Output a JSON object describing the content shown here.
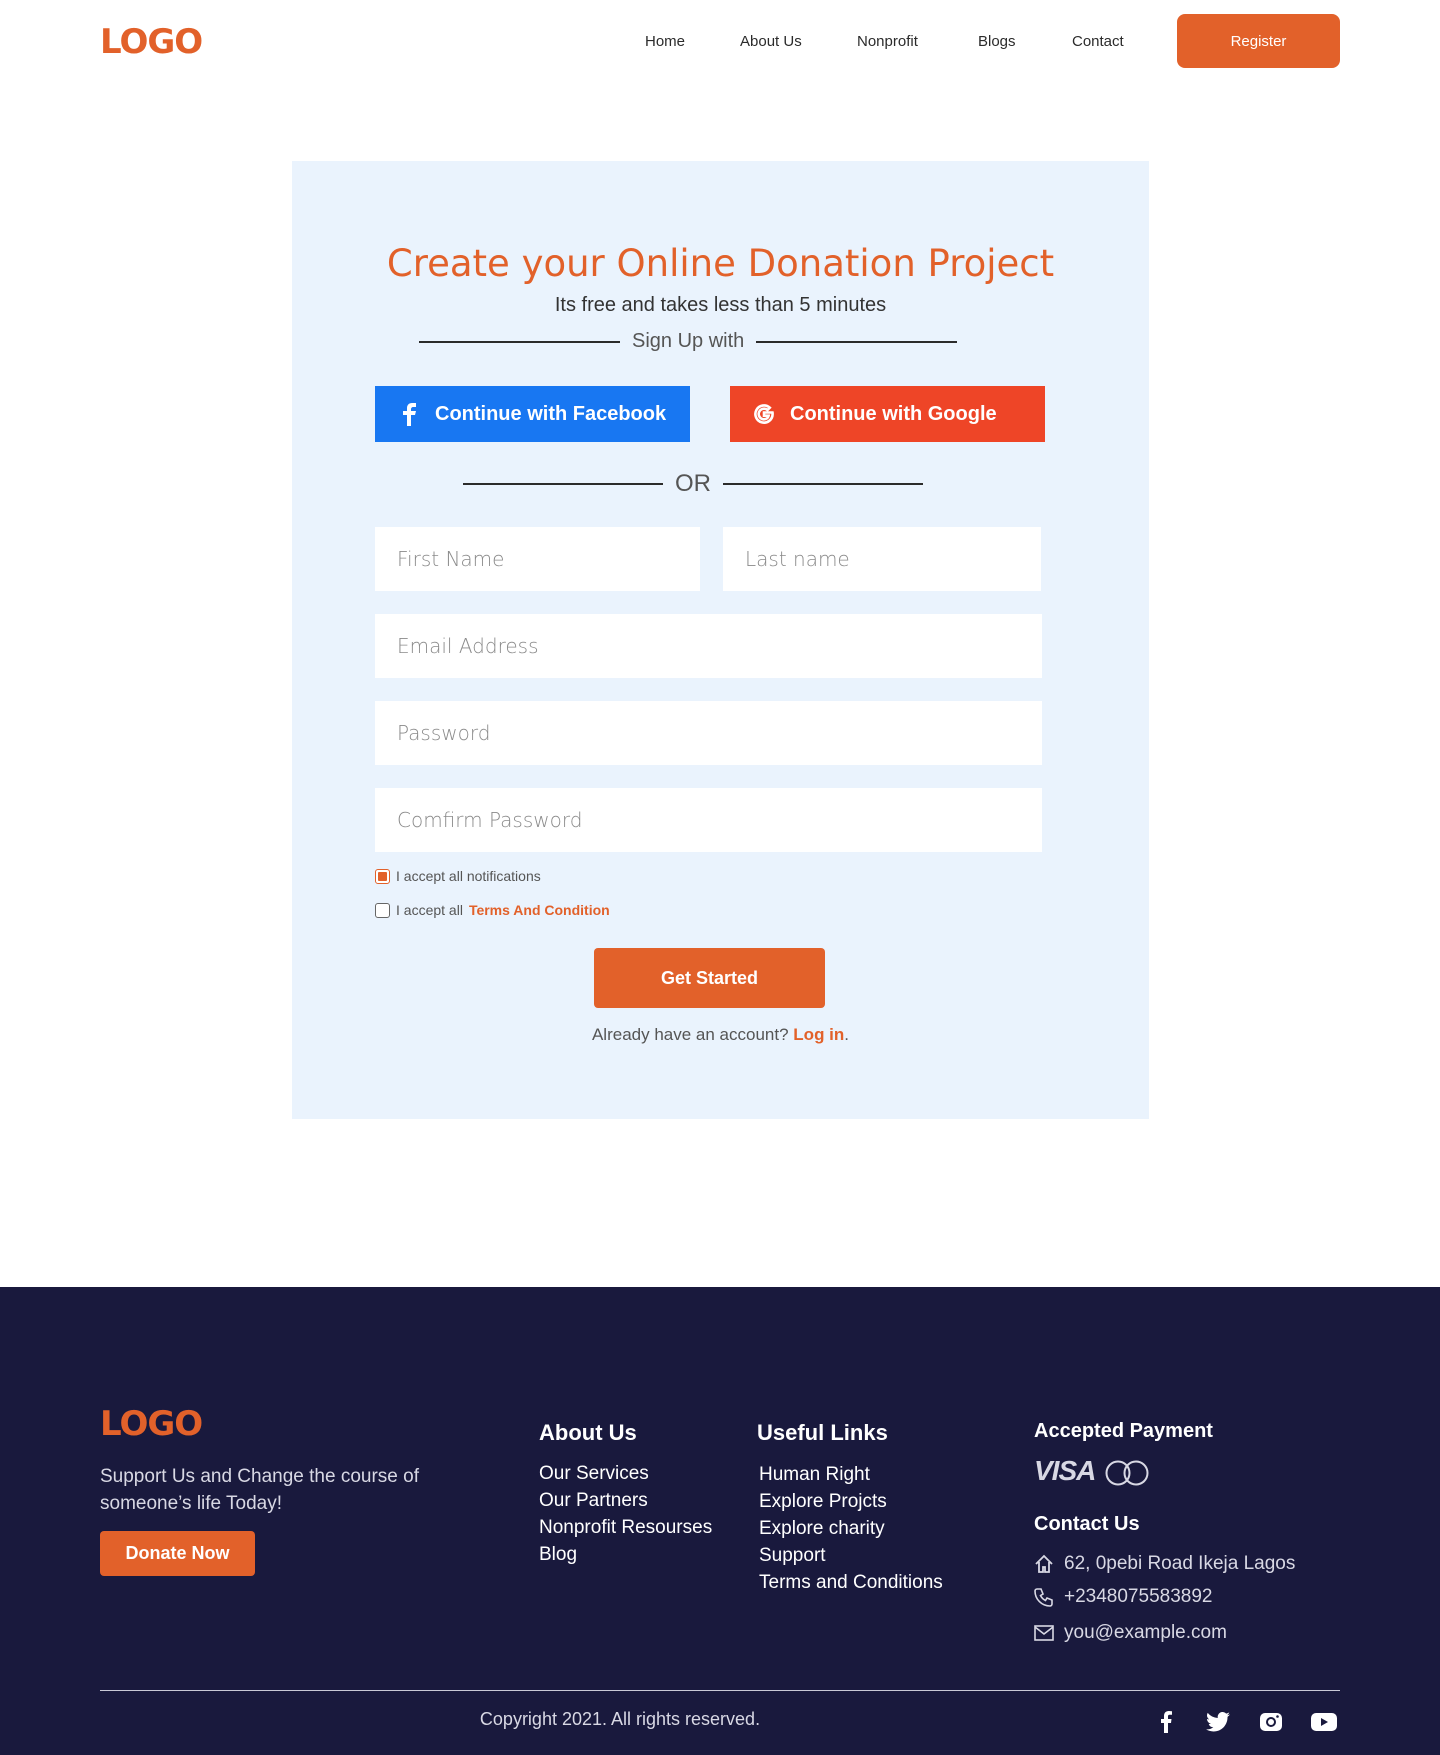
{
  "header": {
    "logo": "LOGO",
    "nav": [
      "Home",
      "About Us",
      "Nonprofit",
      "Blogs",
      "Contact"
    ],
    "register_label": "Register"
  },
  "signup": {
    "title": "Create your Online Donation Project",
    "subtitle": "Its free and takes less than 5 minutes",
    "signup_with": "Sign Up with",
    "facebook_label": "Continue with Facebook",
    "google_label": "Continue with Google",
    "or_text": "OR",
    "fields": {
      "first_name": "First Name",
      "last_name": "Last name",
      "email": "Email Address",
      "password": "Password",
      "confirm_password": "Comfirm Password"
    },
    "notifications_label": "I accept all notifications",
    "notifications_checked": true,
    "terms_prefix": "I accept all",
    "terms_link": "Terms And Condition",
    "terms_checked": false,
    "submit_label": "Get Started",
    "login_prompt": "Already have an account?",
    "login_link": "Log in",
    "login_suffix": "."
  },
  "footer": {
    "logo": "LOGO",
    "tagline": "Support Us and Change the course of someone’s life Today!",
    "donate_label": "Donate Now",
    "about": {
      "title": "About Us",
      "links": [
        "Our Services",
        "Our Partners",
        "Nonprofit Resourses",
        "Blog"
      ]
    },
    "useful": {
      "title": "Useful Links",
      "links": [
        "Human Right",
        "Explore Projcts",
        "Explore charity",
        "Support",
        "Terms and Conditions"
      ]
    },
    "payment": {
      "title": "Accepted Payment",
      "visa": "VISA",
      "icons": [
        "visa-icon",
        "mastercard-icon"
      ]
    },
    "contact": {
      "title": "Contact Us",
      "address": "62, 0pebi Road  Ikeja Lagos",
      "phone": "+2348075583892",
      "email": "you@example.com"
    },
    "copyright": "Copyright 2021. All rights reserved.",
    "social_icons": [
      "facebook-icon",
      "twitter-icon",
      "instagram-icon",
      "youtube-icon"
    ]
  },
  "colors": {
    "accent": "#E2612A",
    "facebook": "#1877F2",
    "google": "#EE4527",
    "card_bg": "#EAF3FD",
    "footer_bg": "#19193D"
  }
}
